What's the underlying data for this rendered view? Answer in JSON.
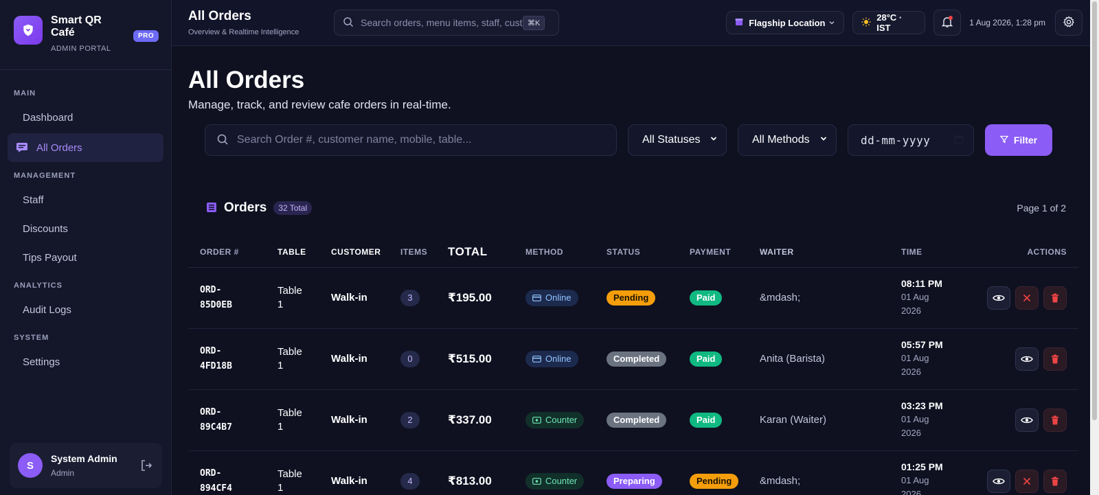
{
  "brand": {
    "name": "Smart QR Café",
    "subtitle": "ADMIN PORTAL",
    "badge": "PRO"
  },
  "nav": {
    "sections": {
      "main": "MAIN",
      "management": "MANAGEMENT",
      "analytics": "ANALYTICS",
      "system": "SYSTEM"
    },
    "items": {
      "dashboard": "Dashboard",
      "all_orders": "All Orders",
      "staff": "Staff",
      "discounts": "Discounts",
      "tips_payout": "Tips Payout",
      "audit_logs": "Audit Logs",
      "settings": "Settings"
    },
    "active": "all_orders"
  },
  "user": {
    "initial": "S",
    "name": "System Admin",
    "role": "Admin"
  },
  "topbar": {
    "title": "All Orders",
    "subtitle": "Overview & Realtime Intelligence",
    "search_placeholder": "Search orders, menu items, staff, customers...",
    "shortcut": "⌘K",
    "location": "Flagship Location",
    "weather": "28°C · IST",
    "datetime": "1 Aug 2026, 1:28 pm"
  },
  "page": {
    "title": "All Orders",
    "subtitle": "Manage, track, and review cafe orders in real-time."
  },
  "filters": {
    "search_placeholder": "Search Order #, customer name, mobile, table...",
    "status_selected": "All Statuses",
    "method_selected": "All Methods",
    "date_placeholder": "dd-mm-yyyy",
    "filter_label": "Filter"
  },
  "orders": {
    "title": "Orders",
    "total_badge": "32 Total",
    "page_info": "Page 1 of 2",
    "columns": [
      "ORDER #",
      "TABLE",
      "CUSTOMER",
      "ITEMS",
      "TOTAL",
      "METHOD",
      "STATUS",
      "PAYMENT",
      "WAITER",
      "TIME",
      "ACTIONS"
    ],
    "rows": [
      {
        "order_l1": "ORD-",
        "order_l2": "85D0EB",
        "table_l1": "Table",
        "table_l2": "1",
        "customer": "Walk-in",
        "items": "3",
        "total": "₹195.00",
        "method": "Online",
        "status": "Pending",
        "payment": "Paid",
        "waiter": "&mdash;",
        "time": "08:11 PM",
        "date_l1": "01 Aug",
        "date_l2": "2026"
      },
      {
        "order_l1": "ORD-",
        "order_l2": "4FD18B",
        "table_l1": "Table",
        "table_l2": "1",
        "customer": "Walk-in",
        "items": "0",
        "total": "₹515.00",
        "method": "Online",
        "status": "Completed",
        "payment": "Paid",
        "waiter": "Anita (Barista)",
        "time": "05:57 PM",
        "date_l1": "01 Aug",
        "date_l2": "2026"
      },
      {
        "order_l1": "ORD-",
        "order_l2": "89C4B7",
        "table_l1": "Table",
        "table_l2": "1",
        "customer": "Walk-in",
        "items": "2",
        "total": "₹337.00",
        "method": "Counter",
        "status": "Completed",
        "payment": "Paid",
        "waiter": "Karan (Waiter)",
        "time": "03:23 PM",
        "date_l1": "01 Aug",
        "date_l2": "2026"
      },
      {
        "order_l1": "ORD-",
        "order_l2": "894CF4",
        "table_l1": "Table",
        "table_l2": "1",
        "customer": "Walk-in",
        "items": "4",
        "total": "₹813.00",
        "method": "Counter",
        "status": "Preparing",
        "payment": "Pending",
        "waiter": "&mdash;",
        "time": "01:25 PM",
        "date_l1": "01 Aug",
        "date_l2": "2026"
      }
    ]
  },
  "colors": {
    "accent": "#8b5cf6",
    "background": "#0f1121",
    "sidebar": "#141729"
  }
}
